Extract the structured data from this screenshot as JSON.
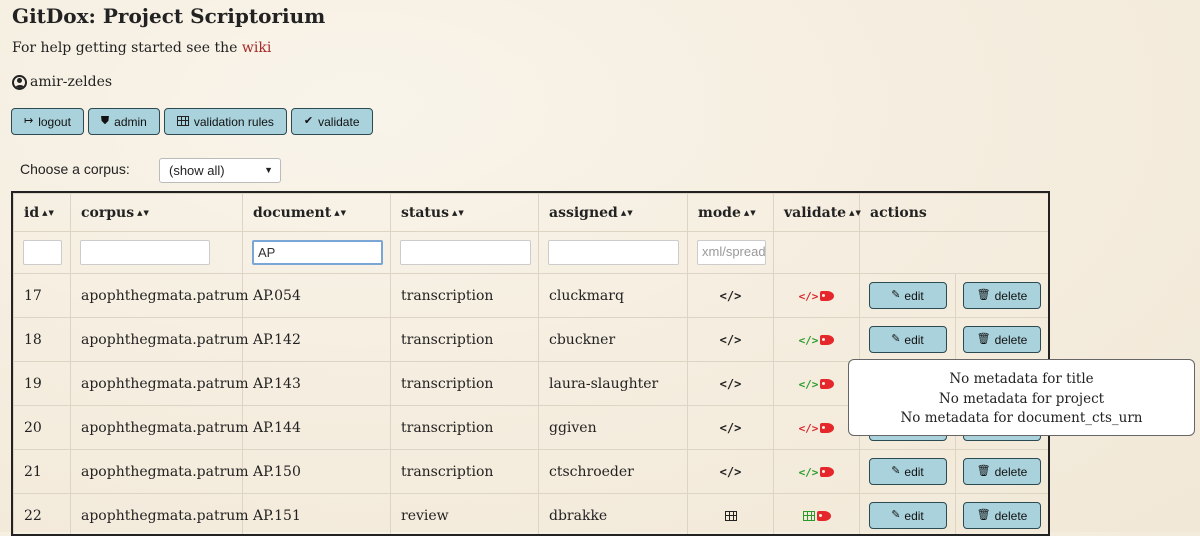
{
  "app_title": "GitDox: Project Scriptorium",
  "help": {
    "prefix": "For help getting started see the ",
    "link": "wiki"
  },
  "user": {
    "name": "amir-zeldes",
    "icon": "user-circle-icon"
  },
  "toolbar": {
    "logout": "logout",
    "admin": "admin",
    "validation_rules": "validation rules",
    "validate": "validate"
  },
  "corpus_filter": {
    "label": "Choose a corpus:",
    "selected": "(show all)"
  },
  "table": {
    "columns": [
      "id",
      "corpus",
      "document",
      "status",
      "assigned",
      "mode",
      "validate",
      "actions"
    ],
    "filters": {
      "document": "AP",
      "mode_placeholder": "xml/spreadsheet"
    },
    "rows": [
      {
        "id": "17",
        "corpus": "apophthegmata.patrum",
        "document": "AP.054",
        "status": "transcription",
        "assigned": "cluckmarq",
        "mode": "xml",
        "validate_color": "#d9262b"
      },
      {
        "id": "18",
        "corpus": "apophthegmata.patrum",
        "document": "AP.142",
        "status": "transcription",
        "assigned": "cbuckner",
        "mode": "xml",
        "validate_color": "#2a9a2a"
      },
      {
        "id": "19",
        "corpus": "apophthegmata.patrum",
        "document": "AP.143",
        "status": "transcription",
        "assigned": "laura-slaughter",
        "mode": "xml",
        "validate_color": "#2a9a2a"
      },
      {
        "id": "20",
        "corpus": "apophthegmata.patrum",
        "document": "AP.144",
        "status": "transcription",
        "assigned": "ggiven",
        "mode": "xml",
        "validate_color": "#d9262b"
      },
      {
        "id": "21",
        "corpus": "apophthegmata.patrum",
        "document": "AP.150",
        "status": "transcription",
        "assigned": "ctschroeder",
        "mode": "xml",
        "validate_color": "#2a9a2a"
      },
      {
        "id": "22",
        "corpus": "apophthegmata.patrum",
        "document": "AP.151",
        "status": "review",
        "assigned": "dbrakke",
        "mode": "spreadsheet",
        "validate_color": "#2a9a2a"
      }
    ],
    "edit_label": "edit",
    "delete_label": "delete"
  },
  "tooltip": {
    "lines": [
      "No metadata for title",
      "No metadata for project",
      "No metadata for document_cts_urn"
    ]
  }
}
